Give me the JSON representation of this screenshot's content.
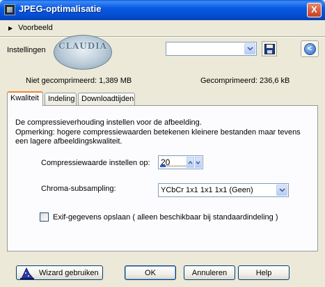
{
  "window": {
    "title": "JPEG-optimalisatie",
    "close_label": "X"
  },
  "preview": {
    "label": "Voorbeeld"
  },
  "settings": {
    "label": "Instellingen",
    "logo_text": "CLAUDIA",
    "preset_value": "",
    "reset_label": "<"
  },
  "sizes": {
    "uncompressed": "Niet gecomprimeerd:  1,389 MB",
    "compressed": "Gecomprimeerd: 236,6 kB"
  },
  "tabs": [
    {
      "label": "Kwaliteit",
      "active": true
    },
    {
      "label": "Indeling",
      "active": false
    },
    {
      "label": "Downloadtijden",
      "active": false
    }
  ],
  "quality": {
    "description": "De compressieverhouding instellen voor de afbeelding.",
    "note": "Opmerking:  hogere compressiewaarden betekenen kleinere bestanden maar tevens een lagere afbeeldingskwaliteit.",
    "compression_label": "Compressiewaarde instellen op:",
    "compression_value": "20",
    "compression_fraction": 0.2,
    "chroma_label": "Chroma-subsampling:",
    "chroma_value": "YCbCr  1x1  1x1  1x1  (Geen)",
    "exif_label": "Exif-gegevens opslaan ( alleen beschikbaar bij standaardindeling )",
    "exif_checked": false
  },
  "buttons": {
    "wizard": "Wizard gebruiken",
    "ok": "OK",
    "cancel": "Annuleren",
    "help": "Help"
  },
  "icons": {
    "title": "app-icon",
    "preview": "triangle-right-icon",
    "save": "floppy-disk-icon",
    "reset": "reset-icon",
    "dropdown": "chevron-down-icon",
    "wizard": "wizard-hat-icon"
  },
  "colors": {
    "titlebar": "#0550d6",
    "window_bg": "#ece9d8",
    "active_tab_accent": "#e68b2c",
    "spinner_bar": "#2f5fd0"
  }
}
